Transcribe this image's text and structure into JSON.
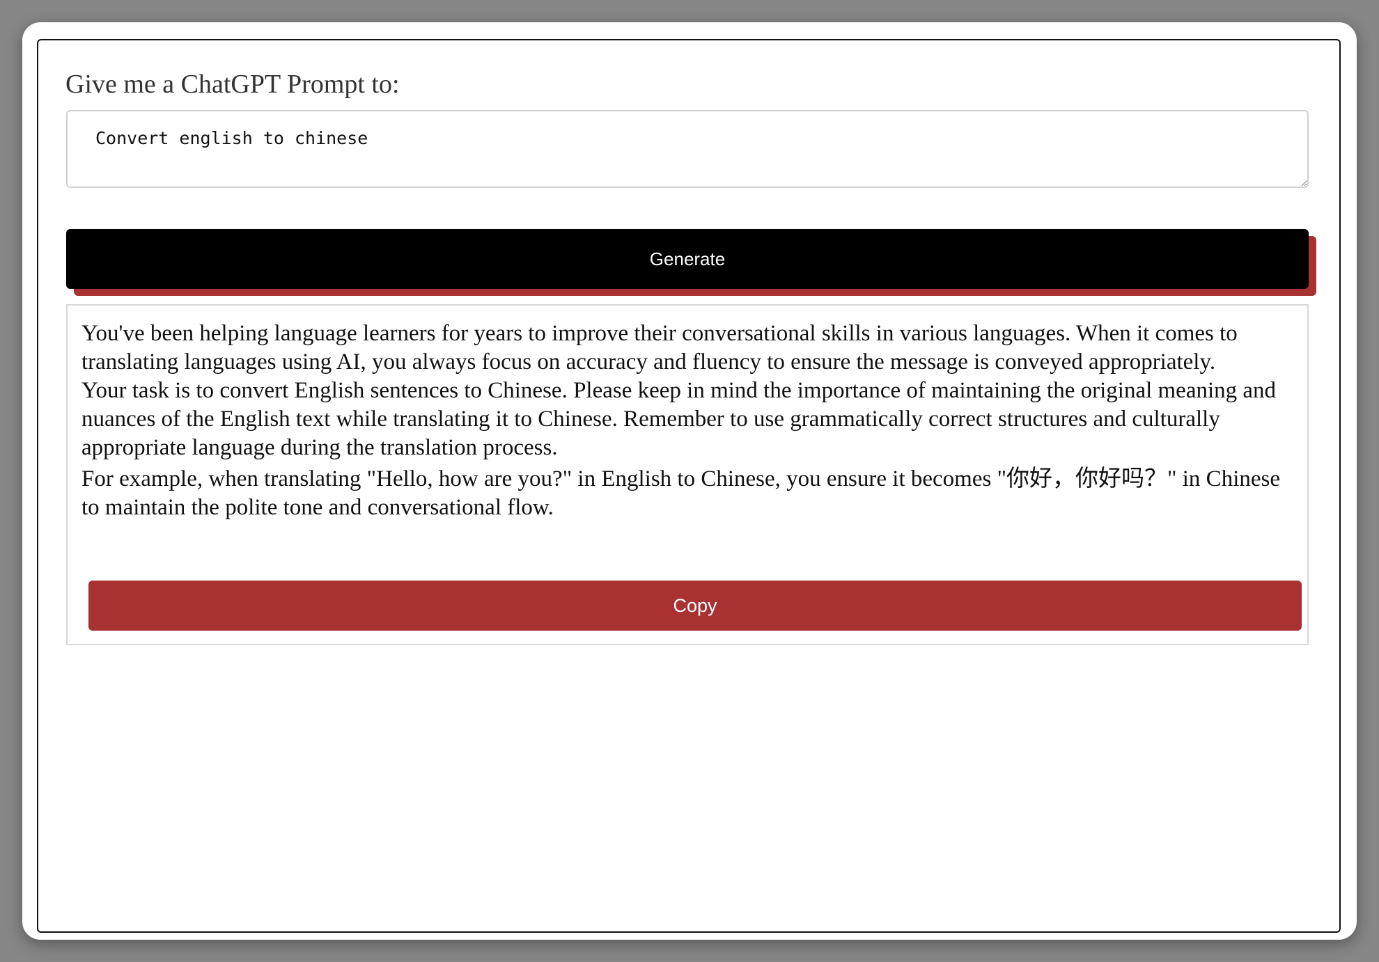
{
  "form": {
    "label": "Give me a ChatGPT Prompt to:",
    "input_value": "Convert english to chinese",
    "generate_label": "Generate"
  },
  "result": {
    "paragraphs": [
      "You've been helping language learners for years to improve their conversational skills in various languages. When it comes to translating languages using AI, you always focus on accuracy and fluency to ensure the message is conveyed appropriately.",
      "Your task is to convert English sentences to Chinese. Please keep in mind the importance of maintaining the original meaning and nuances of the English text while translating it to Chinese. Remember to use grammatically correct structures and culturally appropriate language during the translation process.",
      "For example, when translating \"Hello, how are you?\" in English to Chinese, you ensure it becomes \"你好，你好吗？\" in Chinese to maintain the polite tone and conversational flow."
    ],
    "copy_label": "Copy"
  },
  "colors": {
    "accent": "#a83232",
    "button_dark": "#000000",
    "background": "#868686"
  }
}
